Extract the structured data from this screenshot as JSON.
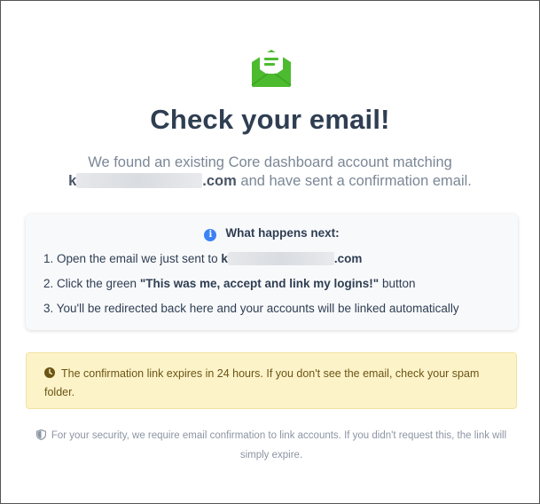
{
  "header": {
    "icon": "envelope-open-icon",
    "title": "Check your email!",
    "subtitle_line1": "We found an existing Core dashboard account matching",
    "email_prefix": "k",
    "email_suffix": ".com",
    "subtitle_line2_rest": " and have sent a confirmation email."
  },
  "next_steps": {
    "icon": "info-icon",
    "heading": "What happens next:",
    "step1_prefix": "1. Open the email we just sent to ",
    "step1_email_prefix": "k",
    "step1_email_suffix": ".com",
    "step2_prefix": "2. Click the green ",
    "step2_bold": "\"This was me, accept and link my logins!\"",
    "step2_suffix": " button",
    "step3": "3. You'll be redirected back here and your accounts will be linked automatically"
  },
  "warning": {
    "icon": "clock-icon",
    "text": "The confirmation link expires in 24 hours. If you don't see the email, check your spam folder."
  },
  "security": {
    "icon": "shield-icon",
    "text": "For your security, we require email confirmation to link accounts. If you didn't request this, the link will simply expire."
  },
  "colors": {
    "accent_green": "#4cbb2f",
    "title": "#2f3e52",
    "info_blue": "#3b82f6",
    "warning_bg": "#fdf3c9"
  }
}
